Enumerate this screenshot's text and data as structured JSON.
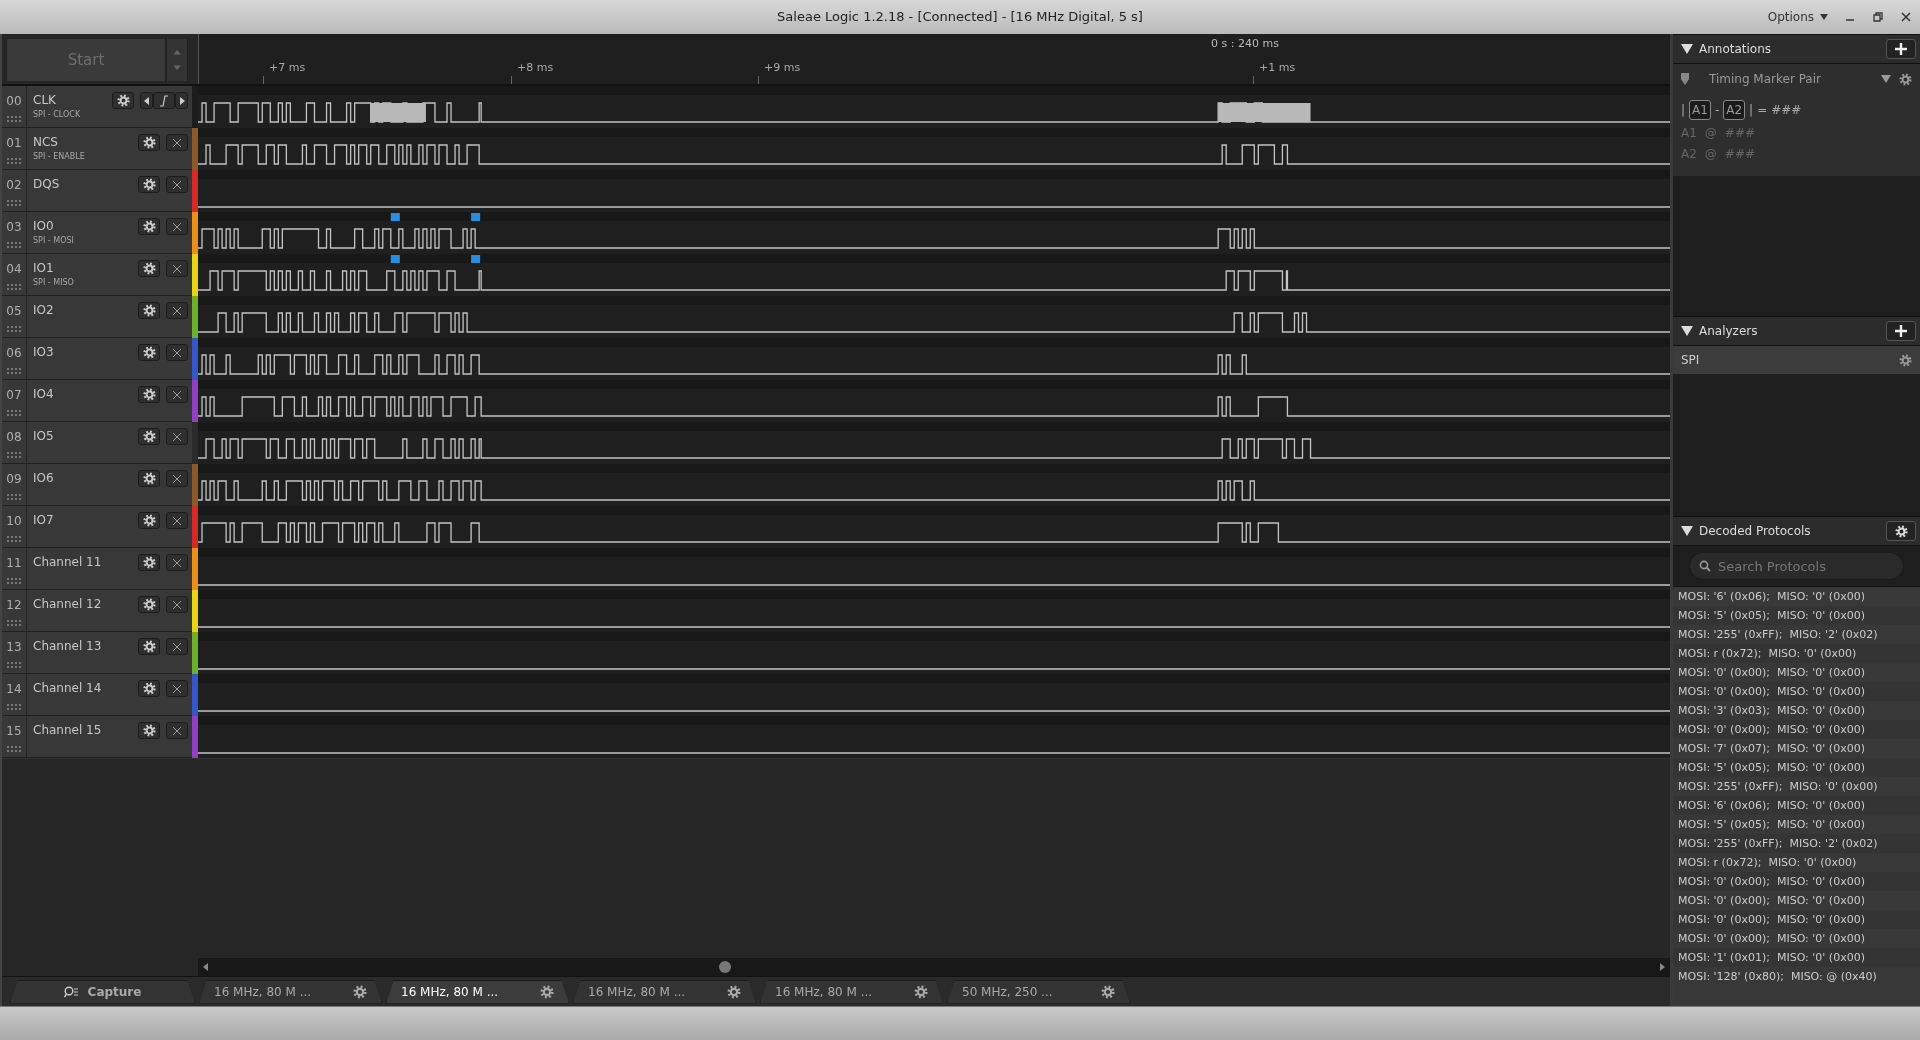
{
  "window": {
    "title": "Saleae Logic 1.2.18 - [Connected] - [16 MHz Digital, 5 s]",
    "menu": "Options"
  },
  "start_button": "Start",
  "ruler": {
    "cursor_time": "0 s : 240 ms",
    "ticks": [
      "+7 ms",
      "+8 ms",
      "+9 ms",
      "+1 ms"
    ]
  },
  "channels": [
    {
      "number": "00",
      "name": "CLK",
      "protocol": "SPI - CLOCK",
      "kind": "clock",
      "color": "#1c1c1c",
      "trace": {
        "kind": "burst"
      }
    },
    {
      "number": "01",
      "name": "NCS",
      "protocol": "SPI - ENABLE",
      "kind": "standard",
      "color": "#8a5a2b",
      "trace": {
        "kind": "burst"
      }
    },
    {
      "number": "02",
      "name": "DQS",
      "kind": "standard",
      "color": "#d42a2a",
      "trace": {
        "kind": "flat"
      }
    },
    {
      "number": "03",
      "name": "IO0",
      "protocol": "SPI - MOSI",
      "kind": "standard",
      "color": "#e8901a",
      "trace": {
        "kind": "marked"
      }
    },
    {
      "number": "04",
      "name": "IO1",
      "protocol": "SPI - MISO",
      "kind": "standard",
      "color": "#e8d21a",
      "trace": {
        "kind": "marked"
      }
    },
    {
      "number": "05",
      "name": "IO2",
      "kind": "standard",
      "color": "#6cb02c",
      "trace": {
        "kind": "burst"
      }
    },
    {
      "number": "06",
      "name": "IO3",
      "kind": "standard",
      "color": "#3656c8",
      "trace": {
        "kind": "burst"
      }
    },
    {
      "number": "07",
      "name": "IO4",
      "kind": "standard",
      "color": "#9040c0",
      "trace": {
        "kind": "burst"
      }
    },
    {
      "number": "08",
      "name": "IO5",
      "kind": "standard",
      "color": "#2a2a2a",
      "trace": {
        "kind": "burst"
      }
    },
    {
      "number": "09",
      "name": "IO6",
      "kind": "standard",
      "color": "#8a5a2b",
      "trace": {
        "kind": "burst"
      }
    },
    {
      "number": "10",
      "name": "IO7",
      "kind": "standard",
      "color": "#d42a2a",
      "trace": {
        "kind": "burst"
      }
    },
    {
      "number": "11",
      "name": "Channel 11",
      "kind": "standard",
      "color": "#e8901a",
      "trace": {
        "kind": "flat"
      }
    },
    {
      "number": "12",
      "name": "Channel 12",
      "kind": "standard",
      "color": "#e8d21a",
      "trace": {
        "kind": "flat"
      }
    },
    {
      "number": "13",
      "name": "Channel 13",
      "kind": "standard",
      "color": "#6cb02c",
      "trace": {
        "kind": "flat"
      }
    },
    {
      "number": "14",
      "name": "Channel 14",
      "kind": "standard",
      "color": "#3656c8",
      "trace": {
        "kind": "flat"
      }
    },
    {
      "number": "15",
      "name": "Channel 15",
      "kind": "standard",
      "color": "#9040c0",
      "trace": {
        "kind": "flat"
      }
    }
  ],
  "annotations": {
    "title": "Annotations",
    "marker_type": "Timing Marker Pair",
    "formula": [
      {
        "text": "|",
        "kind": "symbol"
      },
      {
        "text": "A1",
        "kind": "marker"
      },
      {
        "text": "-",
        "kind": "symbol"
      },
      {
        "text": "A2",
        "kind": "marker"
      },
      {
        "text": "|",
        "kind": "symbol"
      },
      {
        "text": "=",
        "kind": "symbol"
      },
      {
        "text": "###",
        "kind": "symbol"
      }
    ],
    "markers": [
      {
        "label": "A1",
        "at": "@",
        "value": "###"
      },
      {
        "label": "A2",
        "at": "@",
        "value": "###"
      }
    ]
  },
  "analyzers": {
    "title": "Analyzers",
    "items": [
      {
        "name": "SPI"
      }
    ]
  },
  "decoded": {
    "title": "Decoded Protocols",
    "search": {
      "placeholder": "Search Protocols"
    },
    "rows": [
      "MOSI: '6' (0x06);  MISO: '0' (0x00)",
      "MOSI: '5' (0x05);  MISO: '0' (0x00)",
      "MOSI: '255' (0xFF);  MISO: '2' (0x02)",
      "MOSI: r (0x72);  MISO: '0' (0x00)",
      "MOSI: '0' (0x00);  MISO: '0' (0x00)",
      "MOSI: '0' (0x00);  MISO: '0' (0x00)",
      "MOSI: '3' (0x03);  MISO: '0' (0x00)",
      "MOSI: '0' (0x00);  MISO: '0' (0x00)",
      "MOSI: '7' (0x07);  MISO: '0' (0x00)",
      "MOSI: '5' (0x05);  MISO: '0' (0x00)",
      "MOSI: '255' (0xFF);  MISO: '0' (0x00)",
      "MOSI: '6' (0x06);  MISO: '0' (0x00)",
      "MOSI: '5' (0x05);  MISO: '0' (0x00)",
      "MOSI: '255' (0xFF);  MISO: '2' (0x02)",
      "MOSI: r (0x72);  MISO: '0' (0x00)",
      "MOSI: '0' (0x00);  MISO: '0' (0x00)",
      "MOSI: '0' (0x00);  MISO: '0' (0x00)",
      "MOSI: '0' (0x00);  MISO: '0' (0x00)",
      "MOSI: '0' (0x00);  MISO: '0' (0x00)",
      "MOSI: '1' (0x01);  MISO: '0' (0x00)",
      "MOSI: '128' (0x80);  MISO: @ (0x40)"
    ]
  },
  "tabs": [
    {
      "label": "Capture",
      "kind": "capture",
      "selected": false
    },
    {
      "label": "16 MHz, 80 M ...",
      "kind": "session",
      "selected": false
    },
    {
      "label": "16 MHz, 80 M ...",
      "kind": "session",
      "selected": true
    },
    {
      "label": "16 MHz, 80 M ...",
      "kind": "session",
      "selected": false
    },
    {
      "label": "16 MHz, 80 M ...",
      "kind": "session",
      "selected": false
    },
    {
      "label": "50 MHz, 250 ...",
      "kind": "session",
      "selected": false
    }
  ]
}
